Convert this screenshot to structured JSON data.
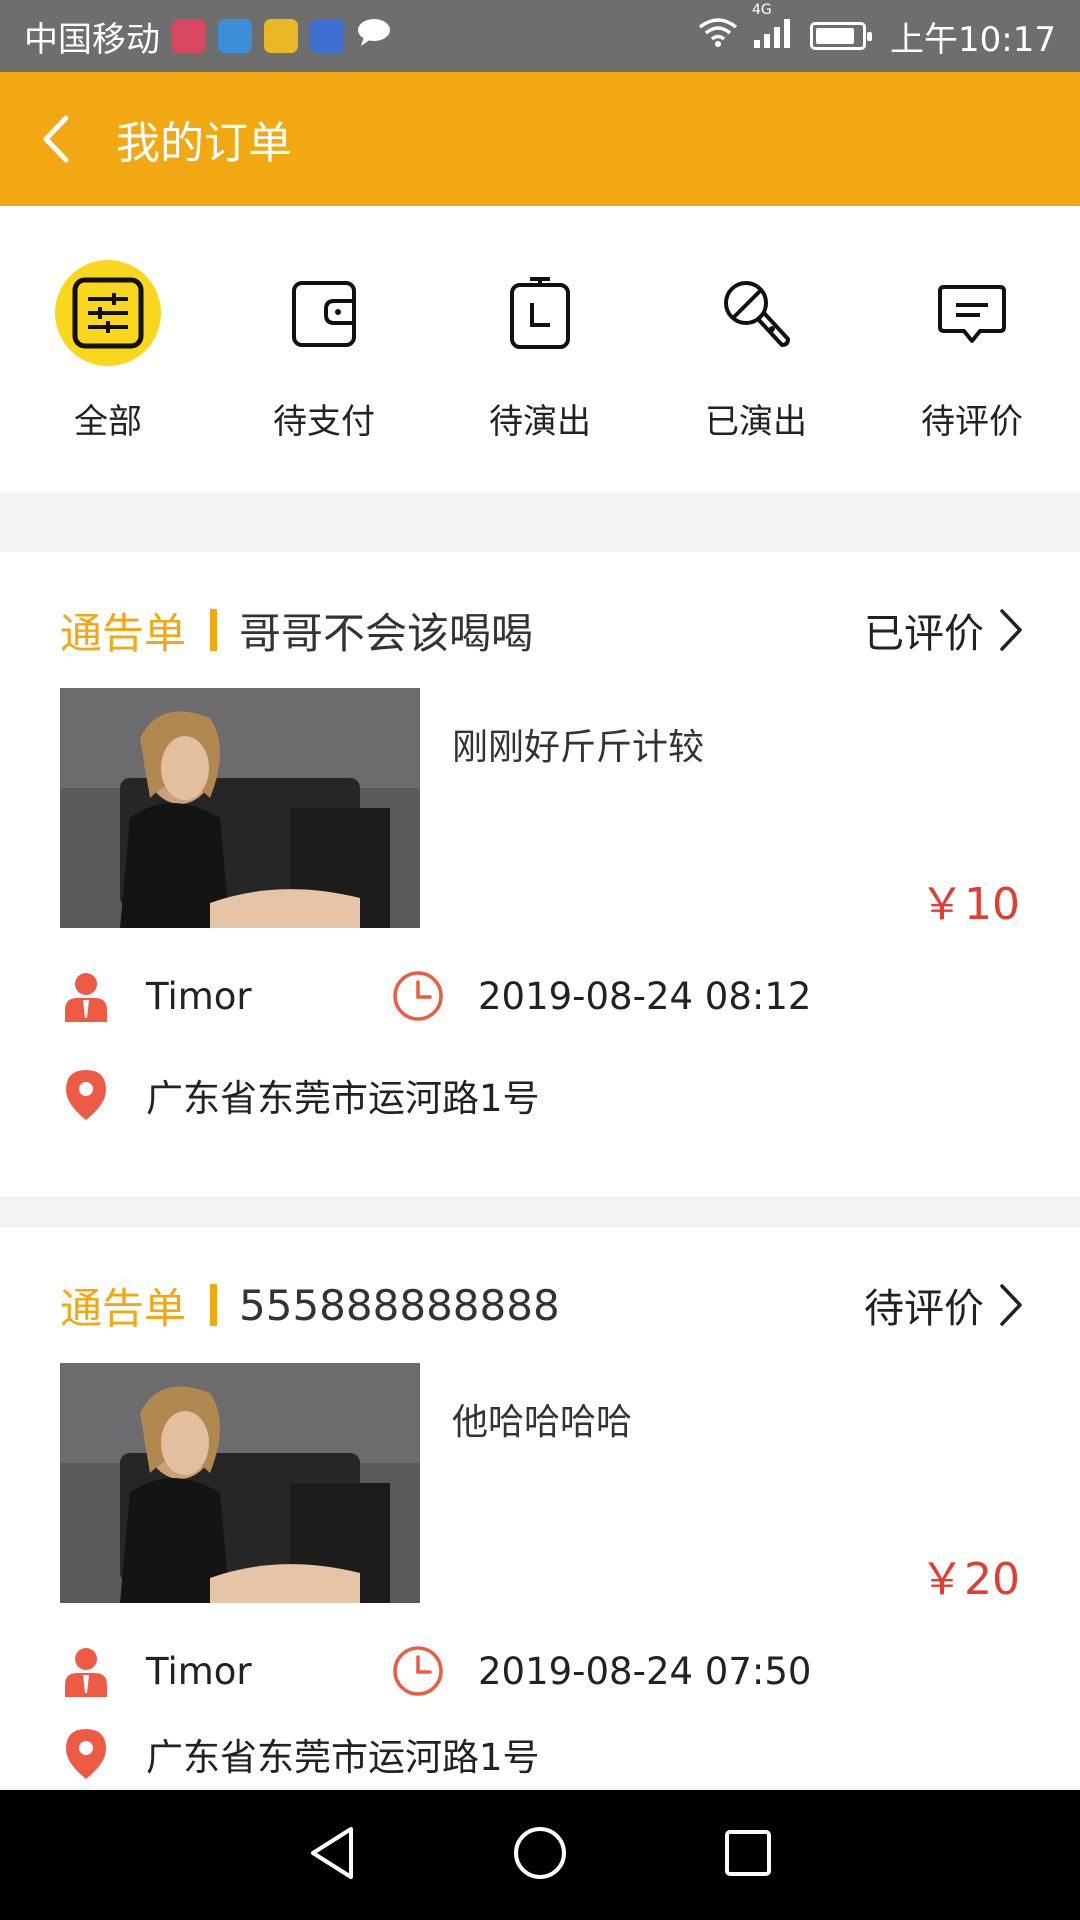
{
  "status_bar": {
    "carrier": "中国移动",
    "time": "上午10:17",
    "network": "4G",
    "app_badge_colors": [
      "#d9485f",
      "#3b8fd9",
      "#e9b824",
      "#3d6fd1"
    ]
  },
  "header": {
    "title": "我的订单"
  },
  "tabs": [
    {
      "label": "全部",
      "icon": "filter-list-icon",
      "active": true
    },
    {
      "label": "待支付",
      "icon": "wallet-icon",
      "active": false
    },
    {
      "label": "待演出",
      "icon": "calendar-timer-icon",
      "active": false
    },
    {
      "label": "已演出",
      "icon": "microphone-icon",
      "active": false
    },
    {
      "label": "待评价",
      "icon": "comment-icon",
      "active": false
    }
  ],
  "orders": [
    {
      "type_label": "通告单",
      "name": "哥哥不会该喝喝",
      "status": "已评价",
      "description": "刚刚好斤斤计较",
      "price": "￥10",
      "user": "Timor",
      "datetime": "2019-08-24 08:12",
      "address": "广东省东莞市运河路1号"
    },
    {
      "type_label": "通告单",
      "name": "555888888888",
      "status": "待评价",
      "description": "他哈哈哈哈",
      "price": "￥20",
      "user": "Timor",
      "datetime": "2019-08-24 07:50",
      "address": "广东省东莞市运河路1号"
    }
  ],
  "colors": {
    "accent": "#f2a812",
    "active_tab": "#f9d71c",
    "price": "#e23c33",
    "meta_icon": "#ee5b45"
  }
}
